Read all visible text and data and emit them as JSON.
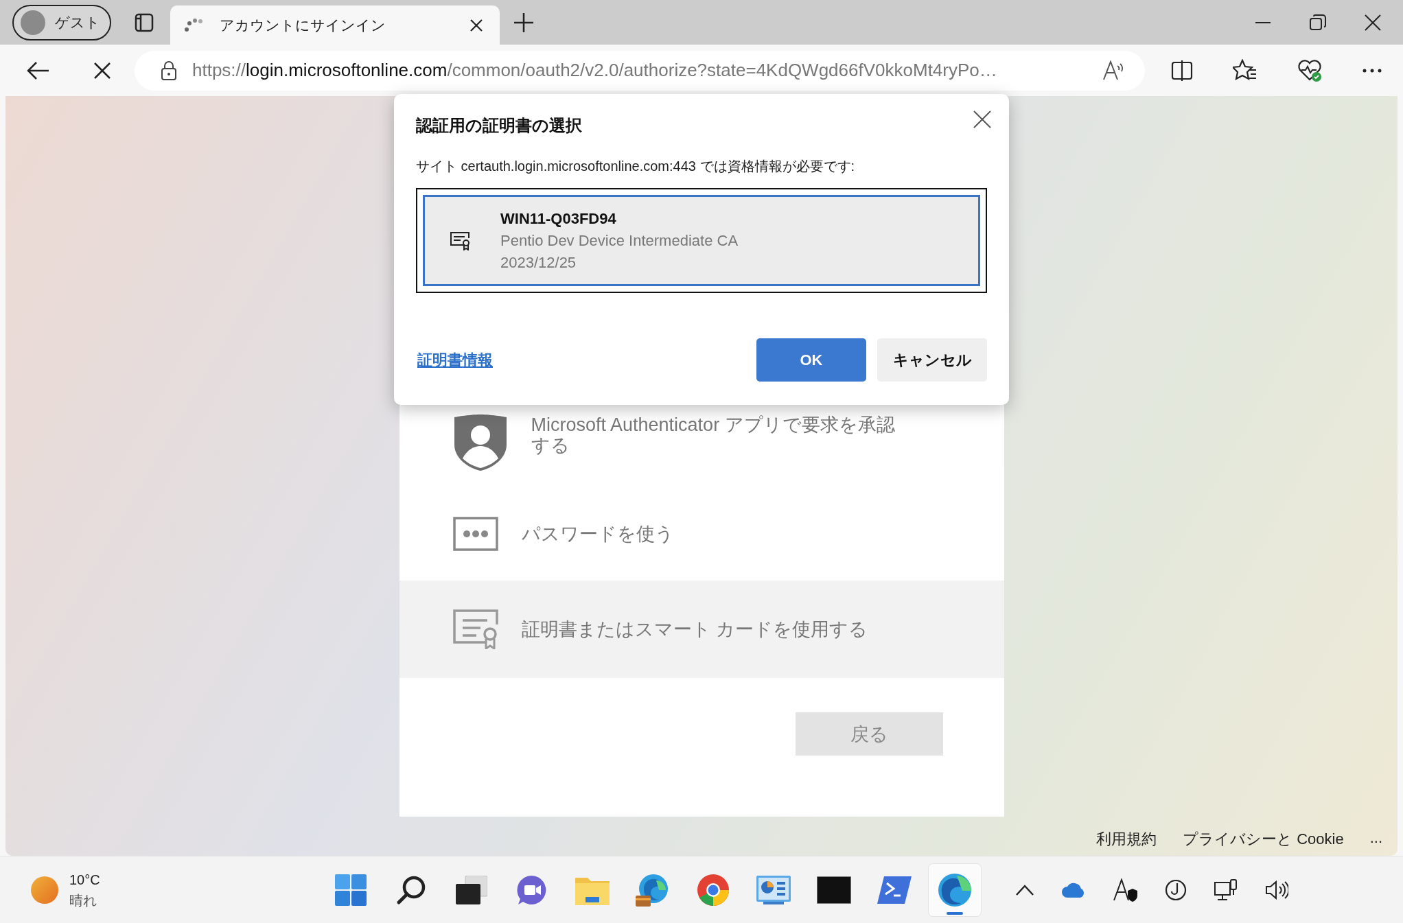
{
  "browser": {
    "profile": {
      "label": "ゲスト"
    },
    "tabs": [
      {
        "title": "アカウントにサインイン",
        "selected": true
      }
    ],
    "address": {
      "scheme": "https://",
      "host": "login.microsoftonline.com",
      "path": "/common/oauth2/v2.0/authorize?state=4KdQWgd66fV0kkoMt4ryPo…"
    }
  },
  "dialog": {
    "title": "認証用の証明書の選択",
    "message": "サイト certauth.login.microsoftonline.com:443 では資格情報が必要です:",
    "certificates": [
      {
        "name": "WIN11-Q03FD94",
        "issuer": "Pentio Dev Device Intermediate CA",
        "date": "2023/12/25",
        "selected": true
      }
    ],
    "info_link": "証明書情報",
    "buttons": [
      {
        "label": "OK",
        "kind": "primary"
      },
      {
        "label": "キャンセル",
        "kind": "secondary"
      }
    ]
  },
  "page": {
    "options": [
      {
        "kind": "authenticator",
        "label": "Microsoft Authenticator アプリで要求を承認する",
        "selected": false
      },
      {
        "kind": "password",
        "label": "パスワードを使う",
        "selected": false
      },
      {
        "kind": "certificate",
        "label": "証明書またはスマート カードを使用する",
        "selected": true
      }
    ],
    "back_button": "戻る",
    "footer": [
      "利用規約",
      "プライバシーと Cookie",
      "..."
    ]
  },
  "taskbar": {
    "weather": {
      "temperature": "10°C",
      "condition": "晴れ"
    },
    "apps": [
      {
        "kind": "start",
        "active": false
      },
      {
        "kind": "search",
        "active": false
      },
      {
        "kind": "taskview",
        "active": false
      },
      {
        "kind": "chat",
        "active": false
      },
      {
        "kind": "explorer",
        "active": false
      },
      {
        "kind": "edge-dev",
        "active": false
      },
      {
        "kind": "chrome",
        "active": false
      },
      {
        "kind": "control-panel",
        "active": false
      },
      {
        "kind": "terminal",
        "active": false
      },
      {
        "kind": "powershell",
        "active": false
      },
      {
        "kind": "edge",
        "active": true
      }
    ],
    "tray": [
      {
        "kind": "chevron"
      },
      {
        "kind": "cloud"
      },
      {
        "kind": "ime"
      },
      {
        "kind": "clock"
      },
      {
        "kind": "network"
      },
      {
        "kind": "volume"
      }
    ]
  }
}
